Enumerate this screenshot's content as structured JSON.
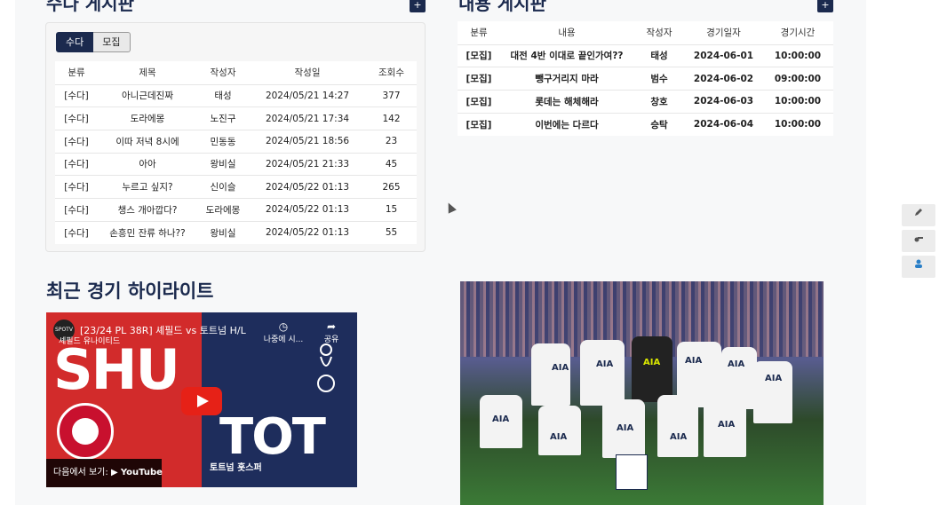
{
  "left_board": {
    "title": "수다 게시판",
    "add_label": "+",
    "tabs": [
      {
        "label": "수다"
      },
      {
        "label": "모집"
      }
    ],
    "headers": [
      "분류",
      "제목",
      "작성자",
      "작성일",
      "조회수"
    ],
    "rows": [
      [
        "[수다]",
        "아니근데진짜",
        "태성",
        "2024/05/21 14:27",
        "377"
      ],
      [
        "[수다]",
        "도라에몽",
        "노진구",
        "2024/05/21 17:34",
        "142"
      ],
      [
        "[수다]",
        "이따 저녁 8시에",
        "민동동",
        "2024/05/21 18:56",
        "23"
      ],
      [
        "[수다]",
        "아아",
        "왕비실",
        "2024/05/21 21:33",
        "45"
      ],
      [
        "[수다]",
        "누르고 싶지?",
        "신이슬",
        "2024/05/22 01:13",
        "265"
      ],
      [
        "[수다]",
        "챙스 개아깝다?",
        "도라에몽",
        "2024/05/22 01:13",
        "15"
      ],
      [
        "[수다]",
        "손흥민 잔류 하나??",
        "왕비실",
        "2024/05/22 01:13",
        "55"
      ]
    ]
  },
  "right_board": {
    "title": "내용 게시판",
    "add_label": "+",
    "headers": [
      "분류",
      "내용",
      "작성자",
      "경기일자",
      "경기시간"
    ],
    "rows": [
      [
        "[모집]",
        "대전 4반 이대로 끝인가여??",
        "태성",
        "2024-06-01",
        "10:00:00"
      ],
      [
        "[모집]",
        "뺑구거리지 마라",
        "범수",
        "2024-06-02",
        "09:00:00"
      ],
      [
        "[모집]",
        "롯데는 해체해라",
        "창호",
        "2024-06-03",
        "10:00:00"
      ],
      [
        "[모집]",
        "이번에는 다르다",
        "승탁",
        "2024-06-04",
        "10:00:00"
      ]
    ]
  },
  "highlight": {
    "title": "최근 경기 하이라이트",
    "video": {
      "channel": "SPOTV",
      "title": "[23/24 PL 38R] 셰필드 vs 토트넘 H/L",
      "subtitle": "셰필드 유나이티드",
      "left_text": "SHU",
      "right_text": "TOT",
      "right_club": "토트넘 홋스퍼",
      "watch_later": "나중에 시...",
      "share": "공유",
      "watch_on": "다음에서 보기:",
      "youtube": "YouTube"
    },
    "photo_sponsor": "AIA"
  },
  "side_widgets": [
    "pencil-icon",
    "whistle-icon",
    "user-icon"
  ]
}
